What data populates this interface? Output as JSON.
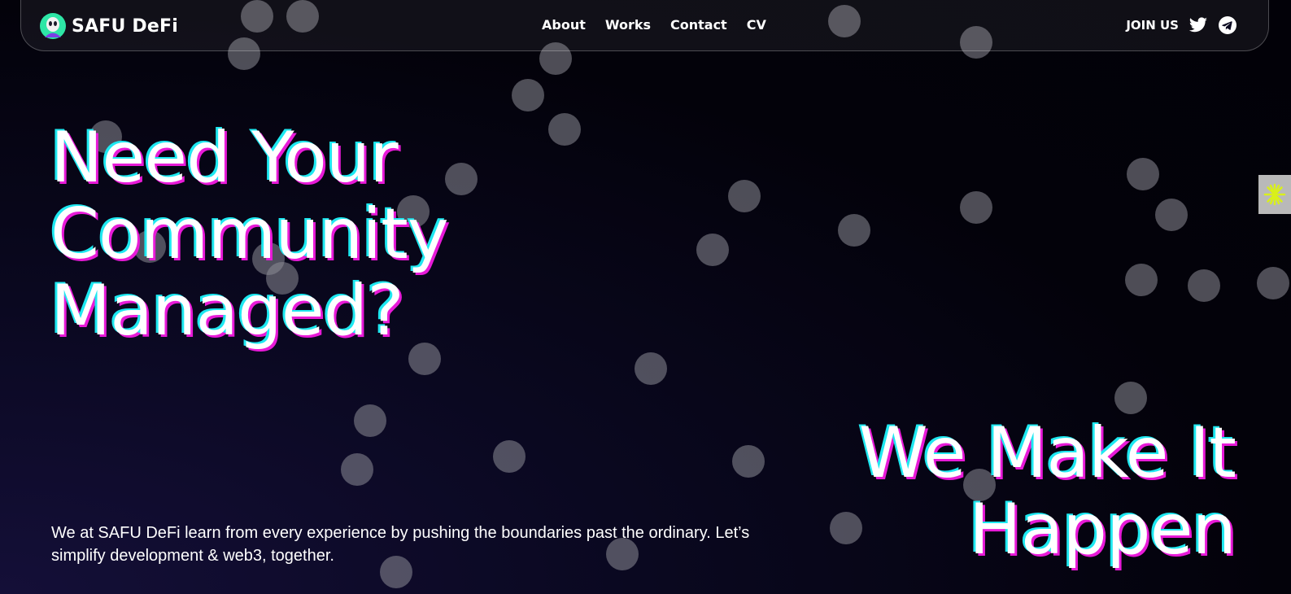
{
  "brand": {
    "name": "SAFU DeFi",
    "logo_icon": "ghost-face-logo-icon"
  },
  "nav": {
    "links": [
      {
        "label": "About"
      },
      {
        "label": "Works"
      },
      {
        "label": "Contact"
      },
      {
        "label": "CV"
      }
    ],
    "join_label": "JOIN US",
    "social_icons": [
      "twitter-icon",
      "telegram-icon"
    ]
  },
  "hero": {
    "headline_lines": [
      "Need Your",
      "Community",
      "Managed?"
    ],
    "tagline_lines": [
      "We Make It",
      "Happen"
    ],
    "description": "We at SAFU DeFi learn from every experience by pushing the boundaries past the ordinary. Let’s simplify development & web3, together."
  },
  "side_widget": {
    "icon": "asterisk-sparkle-icon",
    "color": "#d9f01a"
  },
  "colors": {
    "background": "#03020a",
    "text": "#ffffff",
    "shadow_cyan": "#1ee8f0",
    "shadow_magenta": "#e81ad8",
    "logo_green": "#2ee6a6",
    "logo_purple": "#7b3fe4"
  }
}
